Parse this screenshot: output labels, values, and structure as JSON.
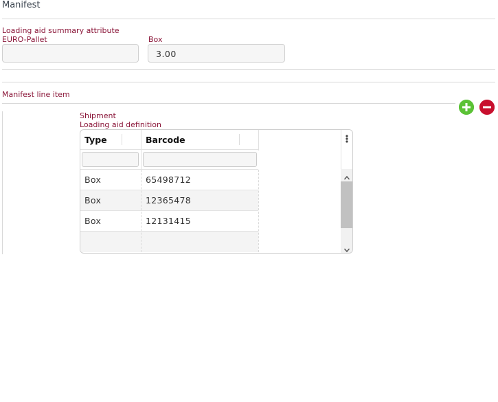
{
  "section": {
    "title": "Manifest"
  },
  "summary": {
    "heading": "Loading aid summary attribute",
    "euro_label": "EURO-Pallet",
    "euro_value": "",
    "box_label": "Box",
    "box_value": "3.00"
  },
  "line_item": {
    "label": "Manifest line item",
    "add_icon": "plus-circle-icon",
    "remove_icon": "minus-circle-icon"
  },
  "shipment": {
    "label": "Shipment",
    "definition_label": "Loading aid definition"
  },
  "table": {
    "columns": [
      "Type",
      "Barcode"
    ],
    "rows": [
      {
        "type": "Box",
        "barcode": "65498712"
      },
      {
        "type": "Box",
        "barcode": "12365478"
      },
      {
        "type": "Box",
        "barcode": "12131415"
      }
    ]
  },
  "colors": {
    "label": "#8a1538",
    "add": "#5bc236",
    "remove": "#c8102e"
  }
}
